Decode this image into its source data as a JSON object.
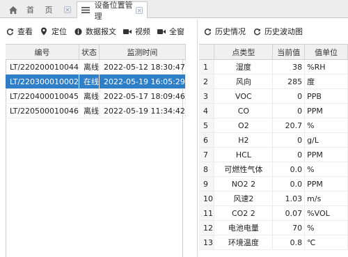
{
  "tabs": [
    {
      "label": "首 页",
      "icon": "home-icon"
    },
    {
      "label": "设备位置管理",
      "icon": "list-icon"
    }
  ],
  "left_toolbar": [
    {
      "label": "查看",
      "icon": "refresh-icon"
    },
    {
      "label": "定位",
      "icon": "location-pin-icon"
    },
    {
      "label": "数据报文",
      "icon": "info-icon"
    },
    {
      "label": "视频",
      "icon": "video-camera-icon"
    },
    {
      "label": "全窗",
      "icon": "video-camera-icon"
    }
  ],
  "right_toolbar": [
    {
      "label": "历史情况",
      "icon": "refresh-icon"
    },
    {
      "label": "历史波动图",
      "icon": "refresh-icon"
    }
  ],
  "device_table": {
    "columns": [
      "编号",
      "状态",
      "监测时间"
    ],
    "rows": [
      [
        "LT/220200010044",
        "离线",
        "2022-05-12 18:30:47"
      ],
      [
        "LT/220300010002",
        "在线",
        "2022-05-19 16:05:29"
      ],
      [
        "LT/220400010045",
        "离线",
        "2022-05-17 18:09:46"
      ],
      [
        "LT/220500010046",
        "离线",
        "2022-05-19 11:34:42"
      ]
    ],
    "selected_row": 1
  },
  "sensor_table": {
    "columns": [
      "",
      "点类型",
      "当前值",
      "值单位"
    ],
    "rows": [
      [
        "1",
        "湿度",
        "38",
        "%RH"
      ],
      [
        "2",
        "风向",
        "285",
        "度"
      ],
      [
        "3",
        "VOC",
        "0",
        "PPB"
      ],
      [
        "4",
        "CO",
        "0",
        "PPM"
      ],
      [
        "5",
        "O2",
        "20.7",
        "%"
      ],
      [
        "6",
        "H2",
        "0",
        "g/L"
      ],
      [
        "7",
        "HCL",
        "0",
        "PPM"
      ],
      [
        "8",
        "可燃性气体",
        "0.0",
        "%"
      ],
      [
        "9",
        "NO2 2",
        "0.0",
        "PPM"
      ],
      [
        "10",
        "风速2",
        "1.03",
        "m/s"
      ],
      [
        "11",
        "CO2 2",
        "0.07",
        "%VOL"
      ],
      [
        "12",
        "电池电量",
        "70",
        "%"
      ],
      [
        "13",
        "环境温度",
        "0.8",
        "℃"
      ]
    ]
  },
  "colors": {
    "selected_row_bg": "#2f7fc8",
    "header_bg": "#f0f0f0"
  }
}
